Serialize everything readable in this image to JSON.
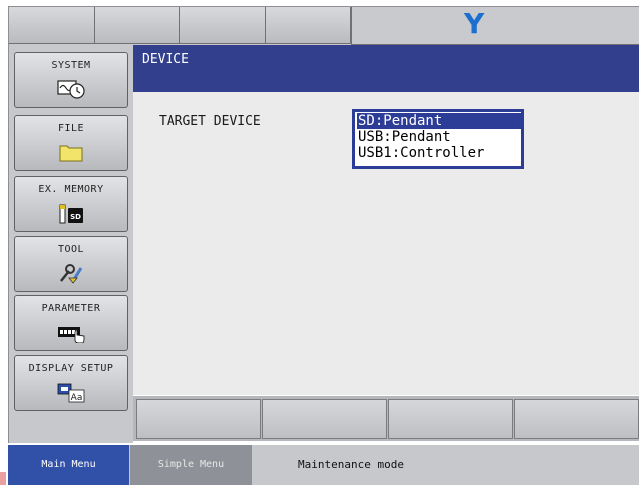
{
  "top_bar": {
    "logo": "Y"
  },
  "menu": [
    {
      "label": "SYSTEM",
      "icon": "system-icon"
    },
    {
      "label": "FILE",
      "icon": "folder-icon"
    },
    {
      "label": "EX. MEMORY",
      "icon": "sd-card-icon"
    },
    {
      "label": "TOOL",
      "icon": "tool-icon"
    },
    {
      "label": "PARAMETER",
      "icon": "parameter-icon"
    },
    {
      "label": "DISPLAY SETUP",
      "icon": "display-setup-icon"
    }
  ],
  "window": {
    "title": "DEVICE"
  },
  "target_device": {
    "label": "TARGET DEVICE",
    "options": [
      "SD:Pendant",
      "USB:Pendant",
      "USB1:Controller"
    ],
    "selected": "SD:Pendant"
  },
  "status_bar": {
    "main_menu": "Main Menu",
    "simple_menu": "Simple Menu",
    "message": "Maintenance mode"
  },
  "colors": {
    "title_bar": "#313f8c",
    "selection": "#2c3d97",
    "logo": "#1b6fd1",
    "main_menu": "#3150a8"
  }
}
